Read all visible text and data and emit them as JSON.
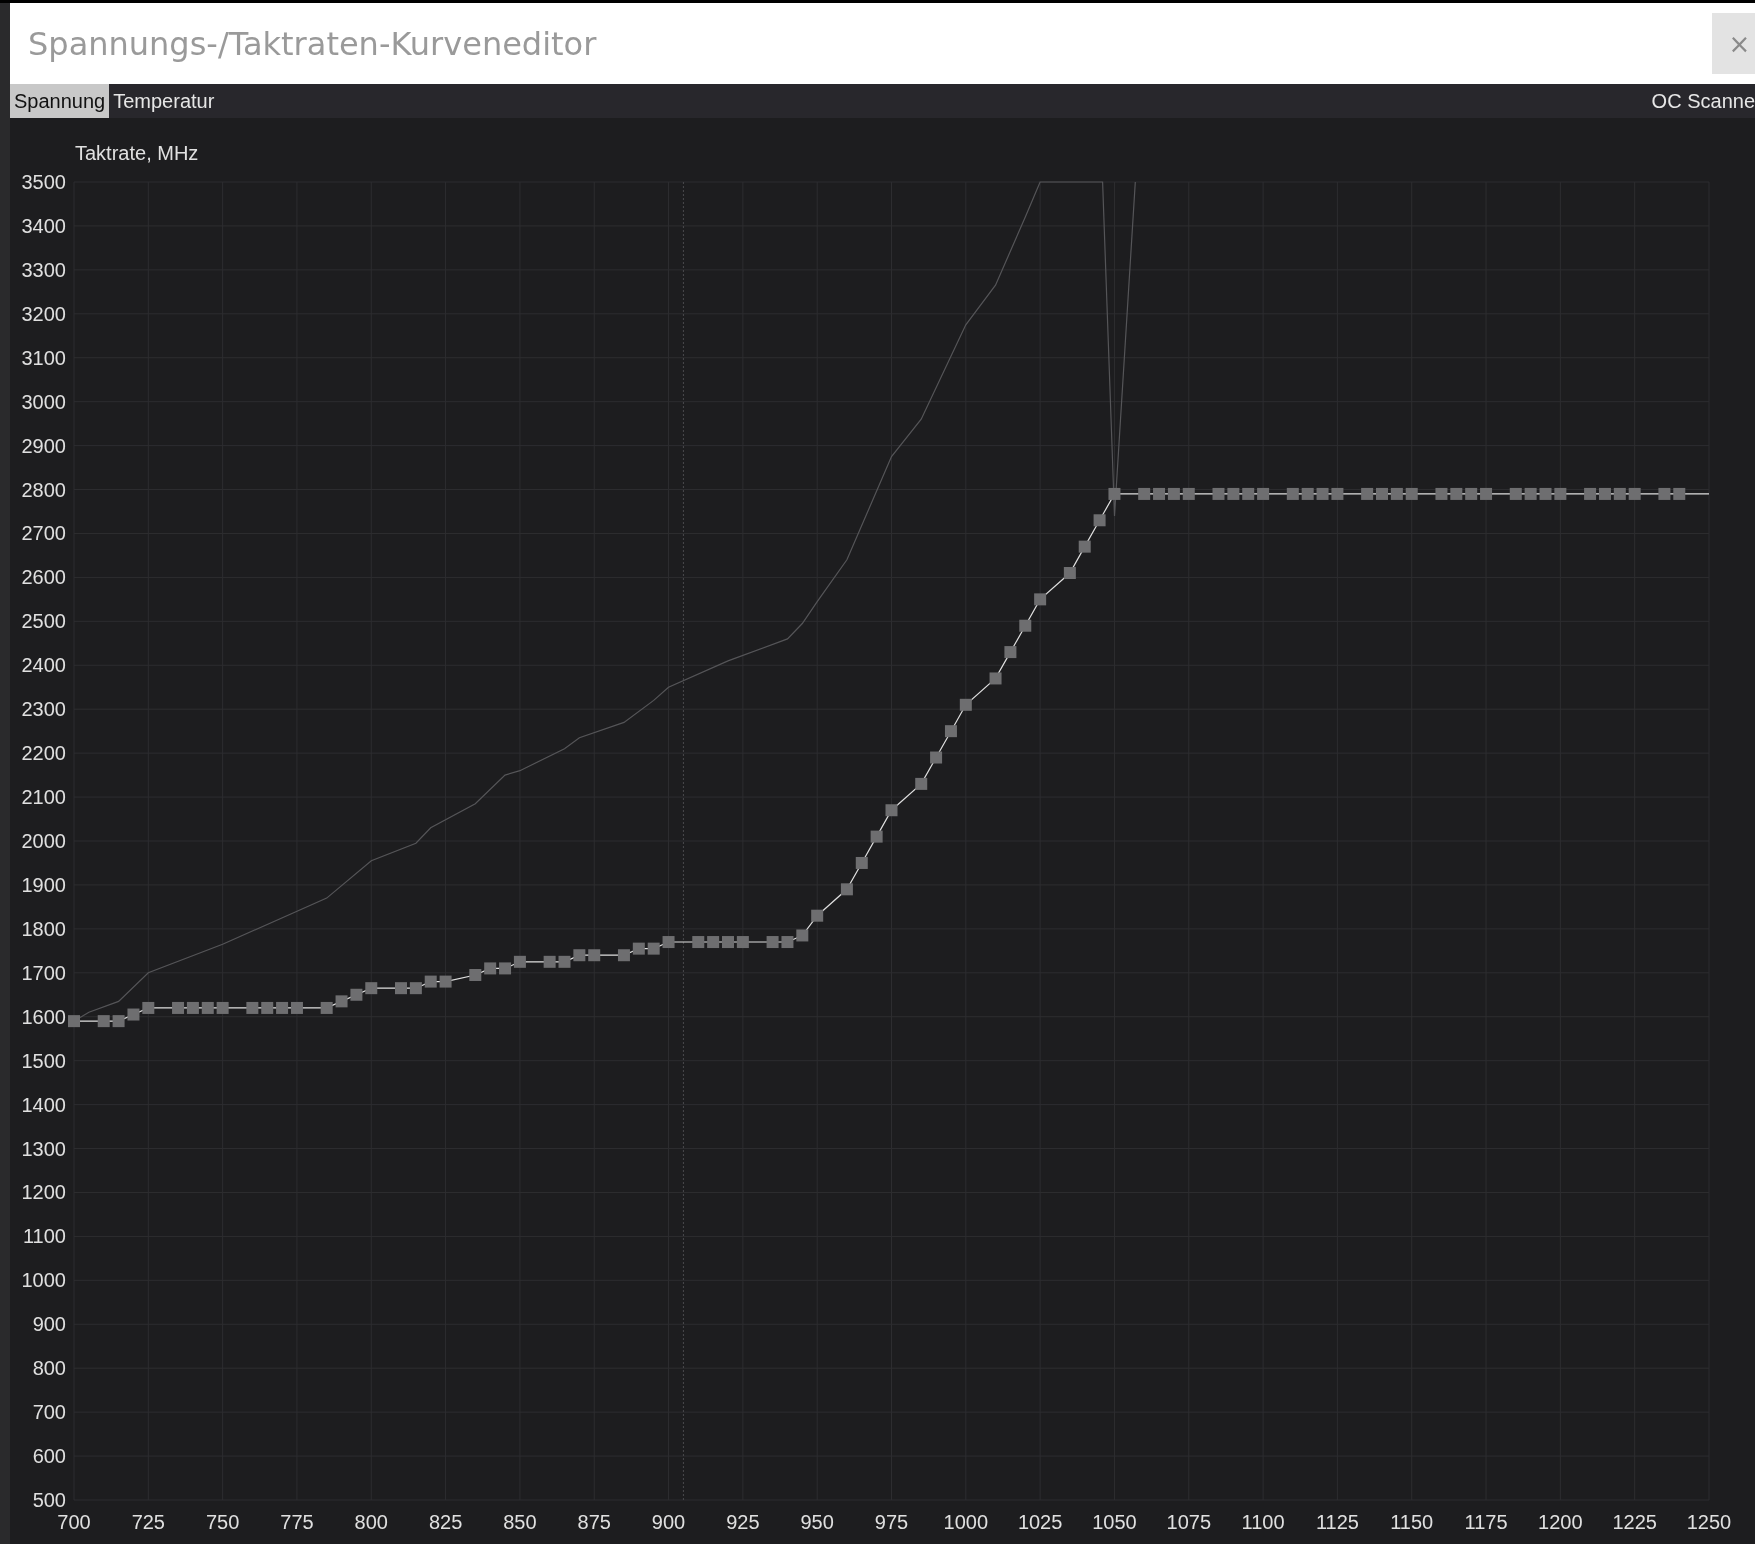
{
  "window": {
    "title": "Spannungs-/Taktraten-Kurveneditor",
    "close_label": "×"
  },
  "tabs": [
    {
      "label": "Spannung",
      "selected": true
    },
    {
      "label": "Temperatur",
      "selected": false
    }
  ],
  "oc_scanner": {
    "label": "OC Scanne"
  },
  "chart": {
    "chart_data": {
      "type": "line",
      "ylabel": "Taktrate, MHz",
      "xlim": [
        700,
        1250
      ],
      "ylim": [
        500,
        3500
      ],
      "xticks": [
        700,
        725,
        750,
        775,
        800,
        825,
        850,
        875,
        900,
        925,
        950,
        975,
        1000,
        1025,
        1050,
        1075,
        1100,
        1125,
        1150,
        1175,
        1200,
        1225,
        1250
      ],
      "yticks": [
        500,
        600,
        700,
        800,
        900,
        1000,
        1100,
        1200,
        1300,
        1400,
        1500,
        1600,
        1700,
        1800,
        1900,
        2000,
        2100,
        2200,
        2300,
        2400,
        2500,
        2600,
        2700,
        2800,
        2900,
        3000,
        3100,
        3200,
        3300,
        3400,
        3500
      ],
      "series": [
        {
          "color": "#555558",
          "marker": "none",
          "x": [
            700,
            705,
            715,
            725,
            750,
            775,
            785,
            800,
            815,
            820,
            835,
            845,
            850,
            865,
            870,
            885,
            895,
            900,
            920,
            940,
            945,
            950,
            960,
            975,
            985,
            1000,
            1010,
            1020,
            1025,
            1046,
            1050,
            1057
          ],
          "values": [
            1590,
            1610,
            1635,
            1700,
            1765,
            1840,
            1870,
            1955,
            1995,
            2030,
            2085,
            2150,
            2160,
            2210,
            2235,
            2270,
            2320,
            2350,
            2410,
            2460,
            2495,
            2545,
            2640,
            2875,
            2960,
            3175,
            3265,
            3420,
            3500,
            3500,
            2740,
            3500
          ]
        },
        {
          "color": "#e0e0e0",
          "marker": "square",
          "x": [
            700,
            710,
            715,
            720,
            725,
            735,
            740,
            745,
            750,
            760,
            765,
            770,
            775,
            785,
            790,
            795,
            800,
            810,
            815,
            820,
            825,
            835,
            840,
            845,
            850,
            860,
            865,
            870,
            875,
            885,
            890,
            895,
            900,
            910,
            915,
            920,
            925,
            935,
            940,
            945,
            950,
            960,
            965,
            970,
            975,
            985,
            990,
            995,
            1000,
            1010,
            1015,
            1020,
            1025,
            1035,
            1040,
            1045,
            1050,
            1060,
            1065,
            1070,
            1075,
            1085,
            1090,
            1095,
            1100,
            1110,
            1115,
            1120,
            1125,
            1135,
            1140,
            1145,
            1150,
            1160,
            1165,
            1170,
            1175,
            1185,
            1190,
            1195,
            1200,
            1210,
            1215,
            1220,
            1225,
            1235,
            1240,
            1250
          ],
          "values": [
            1590,
            1590,
            1590,
            1605,
            1620,
            1620,
            1620,
            1620,
            1620,
            1620,
            1620,
            1620,
            1620,
            1620,
            1635,
            1650,
            1665,
            1665,
            1665,
            1680,
            1680,
            1695,
            1710,
            1710,
            1725,
            1725,
            1725,
            1740,
            1740,
            1740,
            1755,
            1755,
            1770,
            1770,
            1770,
            1770,
            1770,
            1770,
            1770,
            1785,
            1830,
            1890,
            1950,
            2010,
            2070,
            2130,
            2190,
            2250,
            2310,
            2370,
            2430,
            2490,
            2550,
            2610,
            2670,
            2730,
            2790,
            2790,
            2790,
            2790,
            2790,
            2790,
            2790,
            2790,
            2790,
            2790,
            2790,
            2790,
            2790,
            2790,
            2790,
            2790,
            2790,
            2790,
            2790,
            2790,
            2790,
            2790,
            2790,
            2790,
            2790,
            2790,
            2790,
            2790,
            2790,
            2790,
            2790,
            2790
          ]
        }
      ],
      "grid": true,
      "ref_lines": [
        {
          "axis": "x",
          "value": 905
        }
      ]
    }
  }
}
